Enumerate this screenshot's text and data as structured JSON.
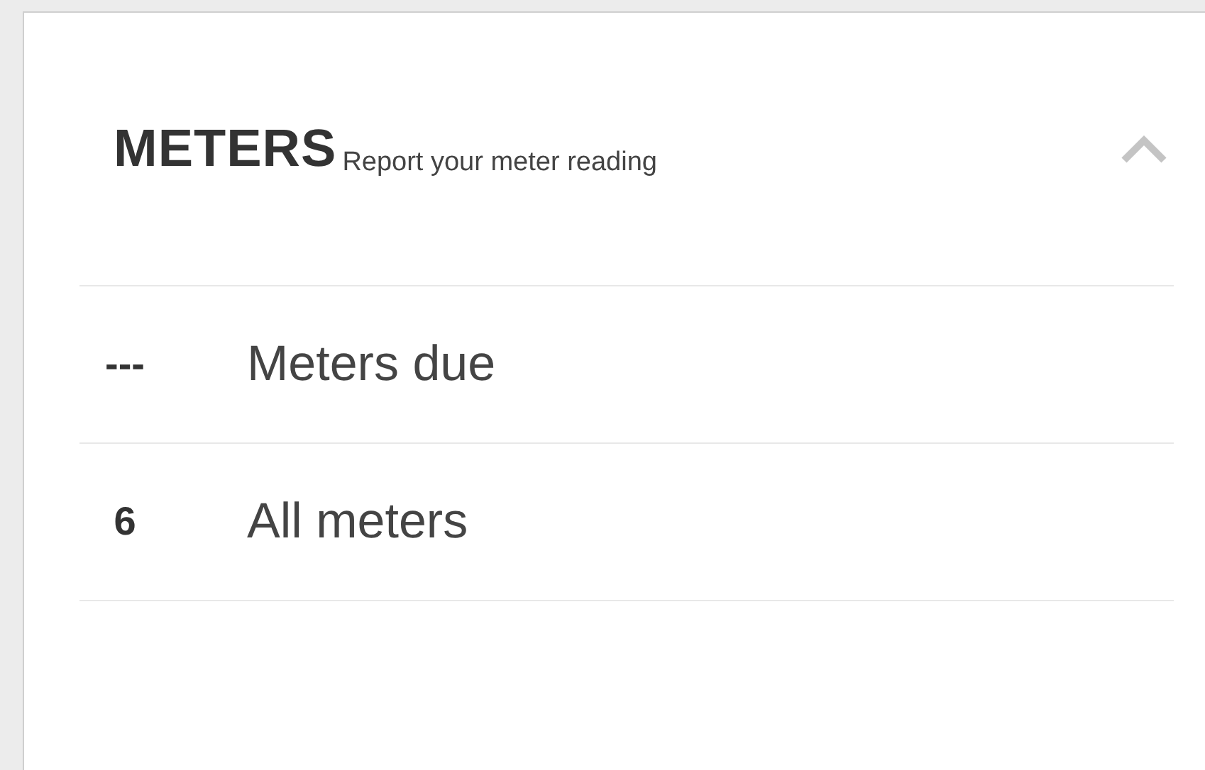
{
  "card": {
    "title": "METERS",
    "subtitle": "Report your meter reading",
    "expanded": true,
    "rows": [
      {
        "count": "---",
        "label": "Meters due"
      },
      {
        "count": "6",
        "label": "All meters"
      }
    ]
  }
}
